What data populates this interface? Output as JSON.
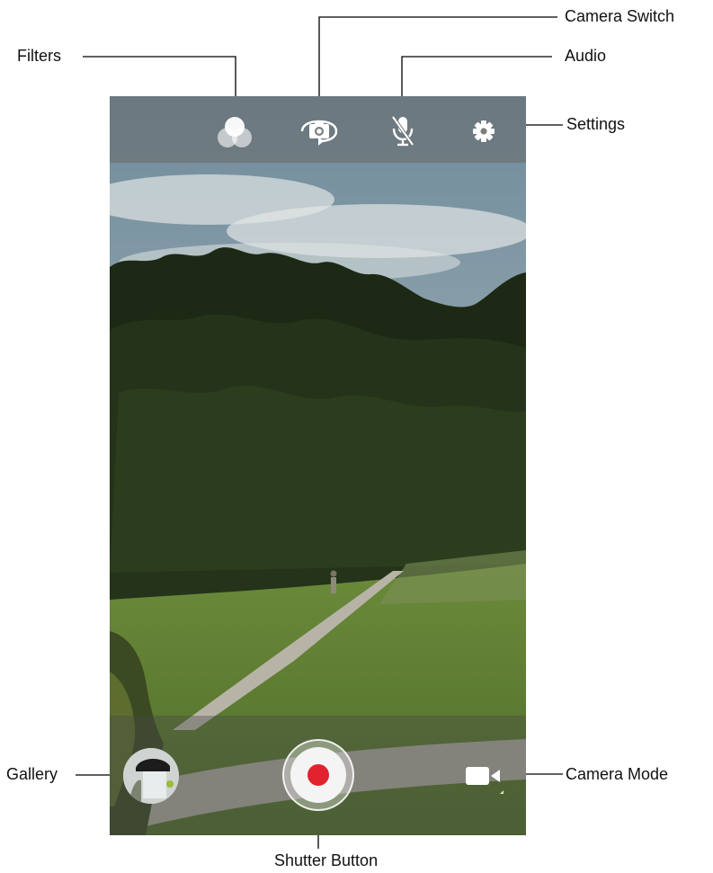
{
  "callouts": {
    "filters": "Filters",
    "camera_switch": "Camera Switch",
    "audio": "Audio",
    "settings": "Settings",
    "gallery": "Gallery",
    "camera_mode": "Camera Mode",
    "shutter": "Shutter Button"
  },
  "camera": {
    "top_bar": {
      "icons": [
        "filters-icon",
        "camera-switch-icon",
        "microphone-muted-icon",
        "gear-icon"
      ]
    },
    "bottom_bar": {
      "gallery_icon": "gallery-thumbnail",
      "shutter_state": "record",
      "mode_icon": "video-camera-icon"
    }
  },
  "colors": {
    "record_red": "#e0232e",
    "icon_white": "#ffffff"
  }
}
